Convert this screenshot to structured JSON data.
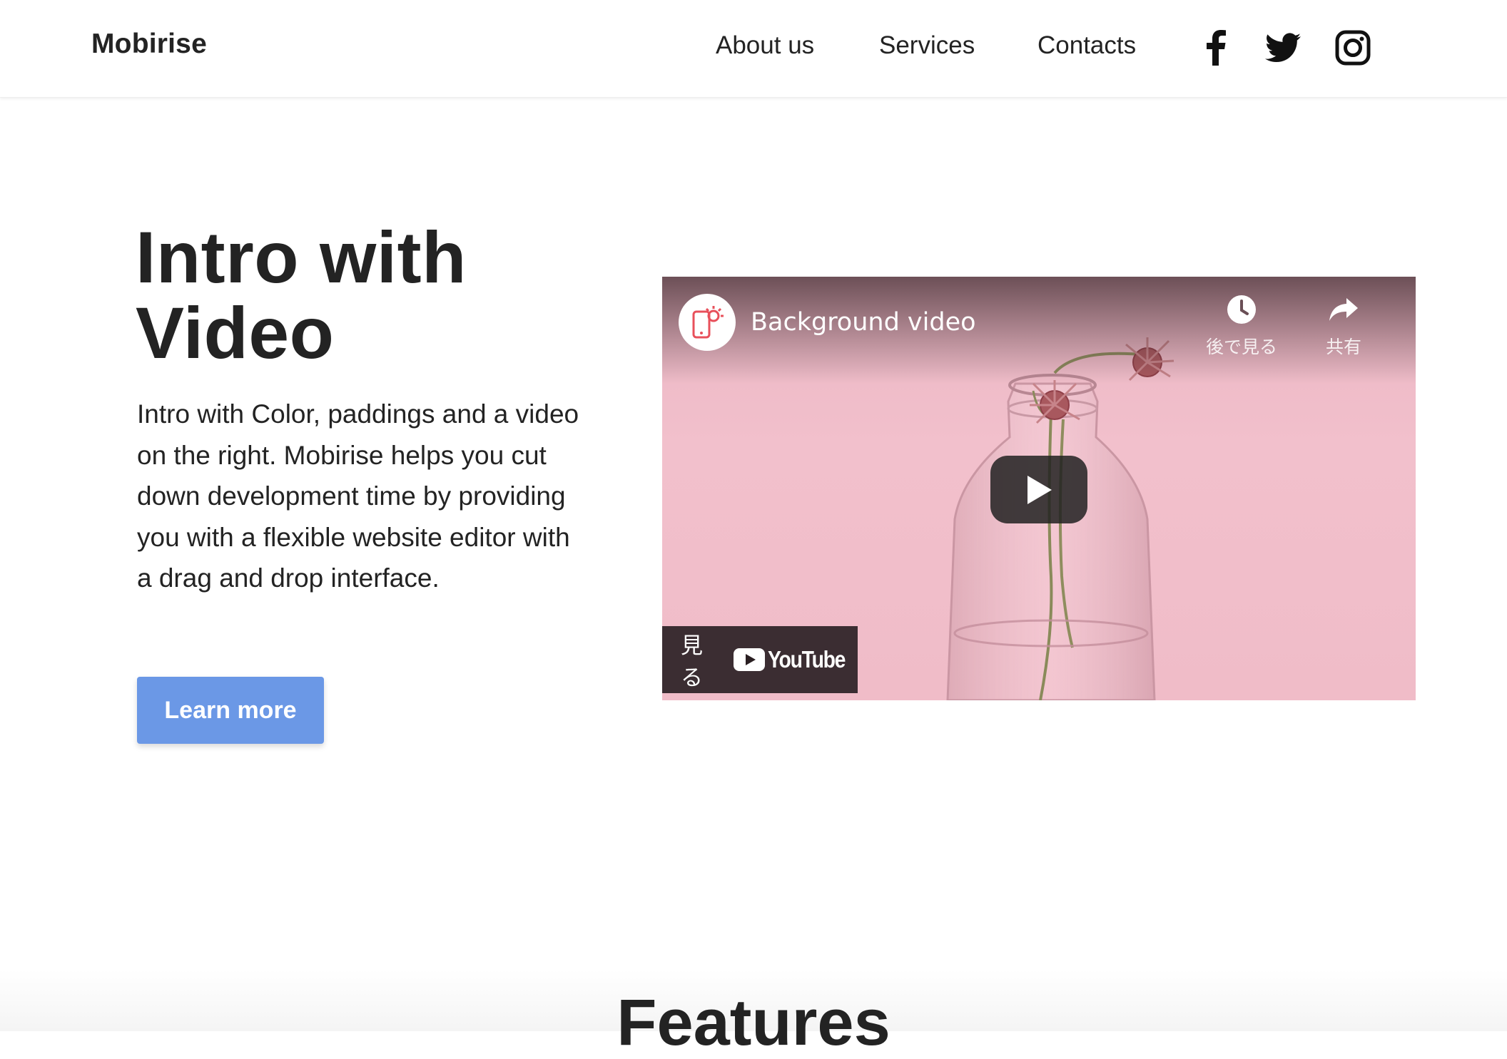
{
  "navbar": {
    "brand": "Mobirise",
    "links": [
      "About us",
      "Services",
      "Contacts"
    ],
    "social_icons": [
      "facebook-icon",
      "twitter-icon",
      "instagram-icon"
    ]
  },
  "hero": {
    "title_line1": "Intro with",
    "title_line2": "Video",
    "text": "Intro with Color, paddings and a video on the right. Mobirise helps you cut down development time by providing you with a flexible website editor with a drag and drop interface.",
    "button_label": "Learn more"
  },
  "video": {
    "title": "Background video",
    "watch_later_label": "後で見る",
    "share_label": "共有",
    "watch_label": "見る",
    "youtube_label": "YouTube",
    "icons": [
      "channel-logo-icon",
      "clock-icon",
      "share-icon",
      "play-icon",
      "youtube-icon"
    ]
  },
  "features": {
    "title": "Features"
  },
  "colors": {
    "accent": "#6b98e6",
    "text": "#232323",
    "video_bg": "#f0bcc8"
  }
}
